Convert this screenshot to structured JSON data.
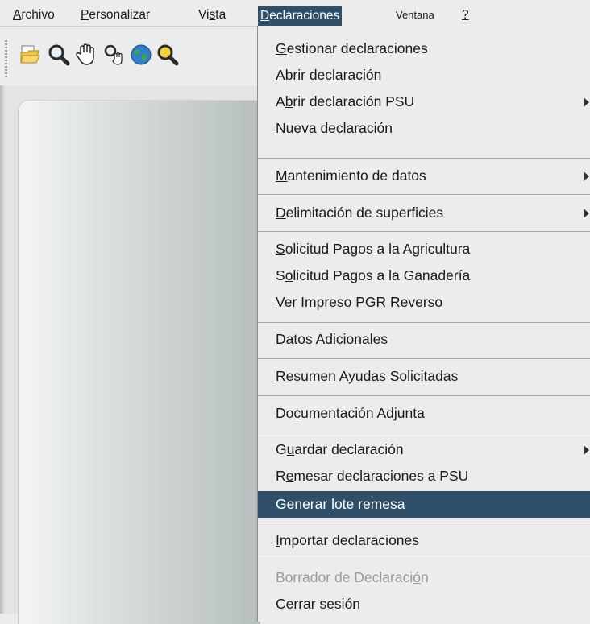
{
  "menubar": {
    "items": [
      {
        "label": "Archivo",
        "mnemonic": "A",
        "rest": "rchivo"
      },
      {
        "label": "Personalizar",
        "mnemonic": "P",
        "rest": "ersonalizar"
      },
      {
        "label": "Vista",
        "pre": "Vi",
        "mnemonic": "s",
        "rest": "ta"
      },
      {
        "label": "Declaraciones",
        "mnemonic": "D",
        "rest": "eclaraciones"
      },
      {
        "label": "Ventana"
      },
      {
        "label": "?"
      }
    ]
  },
  "toolbar": {
    "icons": [
      "open-folder-icon",
      "search-icon",
      "pan-hand-icon",
      "zoom-hand-icon",
      "globe-icon",
      "zoom-icon"
    ]
  },
  "menu": {
    "items": [
      {
        "pre": "",
        "mn": "G",
        "post": "estionar declaraciones",
        "submenu": false
      },
      {
        "pre": "",
        "mn": "A",
        "post": "brir declaración",
        "submenu": false
      },
      {
        "pre": "A",
        "mn": "b",
        "post": "rir declaración PSU",
        "submenu": true
      },
      {
        "pre": "",
        "mn": "N",
        "post": "ueva declaración",
        "submenu": false
      },
      {
        "pre": "",
        "mn": "M",
        "post": "antenimiento de datos",
        "submenu": true
      },
      {
        "pre": "",
        "mn": "D",
        "post": "elimitación de superficies",
        "submenu": true
      },
      {
        "pre": "",
        "mn": "S",
        "post": "olicitud Pagos a la Agricultura",
        "submenu": false
      },
      {
        "pre": "S",
        "mn": "o",
        "post": "licitud Pagos a la Ganadería",
        "submenu": false
      },
      {
        "pre": "",
        "mn": "V",
        "post": "er Impreso PGR Reverso",
        "submenu": false
      },
      {
        "pre": "Da",
        "mn": "t",
        "post": "os Adicionales",
        "submenu": false
      },
      {
        "pre": "",
        "mn": "R",
        "post": "esumen Ayudas Solicitadas",
        "submenu": false
      },
      {
        "pre": "Do",
        "mn": "c",
        "post": "umentación Adjunta",
        "submenu": false
      },
      {
        "pre": "G",
        "mn": "u",
        "post": "ardar declaración",
        "submenu": true
      },
      {
        "pre": "R",
        "mn": "e",
        "post": "mesar declaraciones a PSU",
        "submenu": false
      },
      {
        "pre": "Generar ",
        "mn": "l",
        "post": "ote remesa",
        "submenu": false,
        "selected": true
      },
      {
        "pre": "",
        "mn": "I",
        "post": "mportar declaraciones",
        "submenu": false
      },
      {
        "pre": "Borrador de Declaraci",
        "mn": "ó",
        "post": "n",
        "submenu": false,
        "disabled": true
      },
      {
        "pre": "Cerrar sesión",
        "mn": "",
        "post": "",
        "submenu": false
      }
    ]
  },
  "colors": {
    "selection": "#2f4f68",
    "menu_bg": "#ececec"
  }
}
